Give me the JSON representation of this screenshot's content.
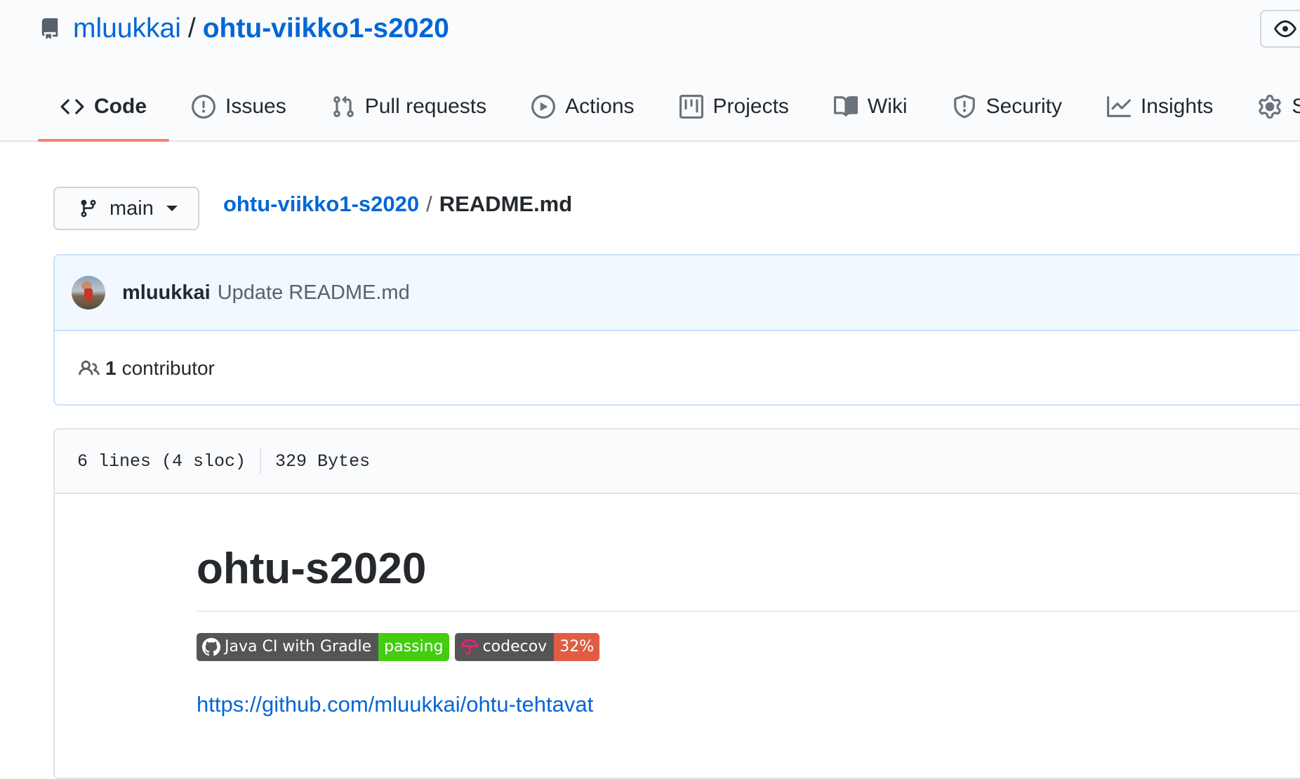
{
  "repo": {
    "owner": "mluukkai",
    "separator": "/",
    "name": "ohtu-viikko1-s2020"
  },
  "tabs": [
    {
      "label": "Code",
      "icon": "code-icon",
      "selected": true
    },
    {
      "label": "Issues",
      "icon": "issue-icon"
    },
    {
      "label": "Pull requests",
      "icon": "pull-request-icon"
    },
    {
      "label": "Actions",
      "icon": "play-icon"
    },
    {
      "label": "Projects",
      "icon": "project-icon"
    },
    {
      "label": "Wiki",
      "icon": "book-icon"
    },
    {
      "label": "Security",
      "icon": "shield-icon"
    },
    {
      "label": "Insights",
      "icon": "graph-icon"
    },
    {
      "label": "Se",
      "icon": "gear-icon"
    }
  ],
  "branch": {
    "label": "main"
  },
  "breadcrumb": {
    "repo_link": "ohtu-viikko1-s2020",
    "separator": "/",
    "file": "README.md"
  },
  "commit": {
    "author": "mluukkai",
    "message": "Update README.md"
  },
  "contributors": {
    "count": "1",
    "label": "contributor"
  },
  "file_info": {
    "lines": "6 lines (4 sloc)",
    "size": "329 Bytes"
  },
  "readme": {
    "heading": "ohtu-s2020",
    "badges": [
      {
        "left": "Java CI with Gradle",
        "right": "passing",
        "icon": "github-icon",
        "right_color": "#4c1"
      },
      {
        "left": "codecov",
        "right": "32%",
        "icon": "codecov-umbrella-icon",
        "right_color": "#e05d44"
      }
    ],
    "link": "https://github.com/mluukkai/ohtu-tehtavat"
  },
  "colors": {
    "link": "#0366d6",
    "selected_tab_underline": "#f9826c"
  }
}
